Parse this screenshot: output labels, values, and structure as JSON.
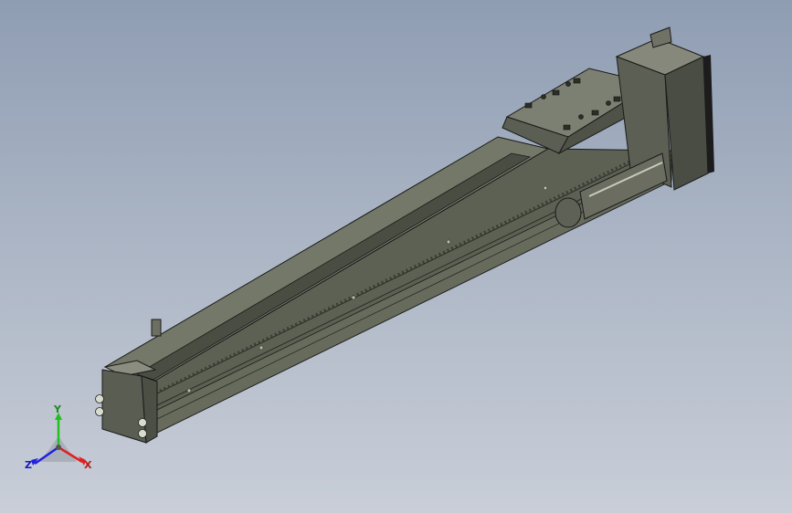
{
  "scene": {
    "model": "linear-actuator-module"
  },
  "triad": {
    "x_label": "X",
    "y_label": "Y",
    "z_label": "Z",
    "colors": {
      "x": "#e02020",
      "y": "#20c020",
      "z": "#2020e0"
    }
  },
  "colors": {
    "body": "#5d6154",
    "body_light": "#7a7e70",
    "body_dark": "#3f4238",
    "edge": "#1a1a1a"
  }
}
